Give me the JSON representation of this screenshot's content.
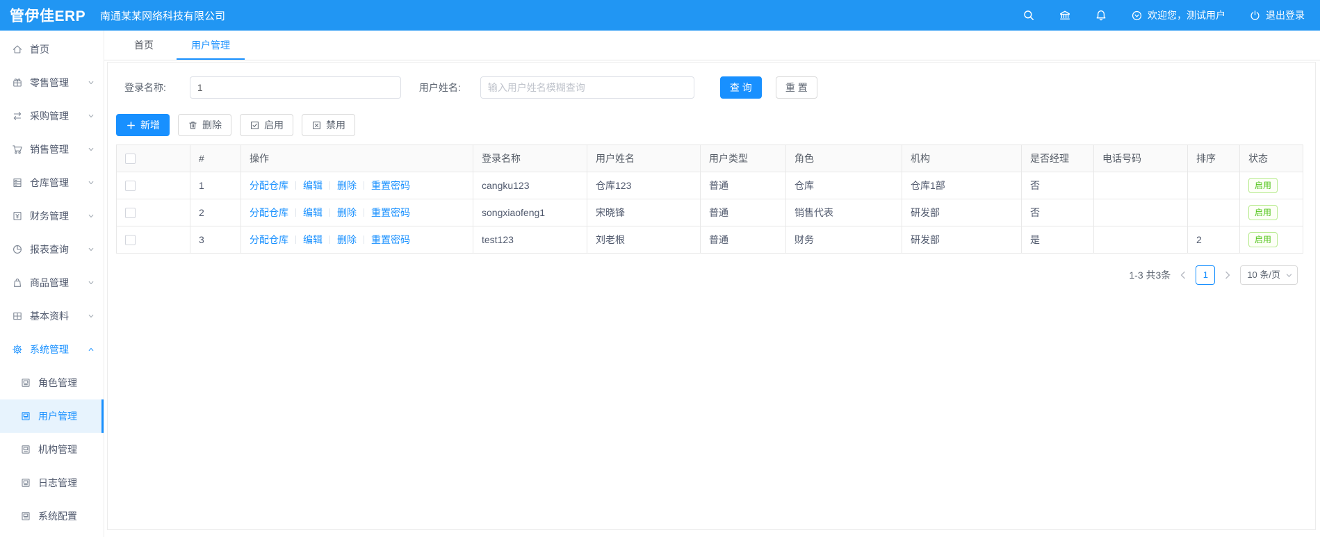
{
  "colors": {
    "topbar": "#2196f3",
    "primary": "#1890ff",
    "link": "#1890ff",
    "status_green": "#52c41a",
    "active_menu_bg": "#e7f3fd"
  },
  "header": {
    "logo": "管伊佳ERP",
    "company": "南通某某网络科技有限公司",
    "welcome": "欢迎您，测试用户",
    "logout": "退出登录"
  },
  "sidebar": {
    "items": [
      {
        "label": "首页",
        "icon": "home-icon"
      },
      {
        "label": "零售管理",
        "icon": "retail-icon"
      },
      {
        "label": "采购管理",
        "icon": "purchase-icon"
      },
      {
        "label": "销售管理",
        "icon": "sales-cart-icon"
      },
      {
        "label": "仓库管理",
        "icon": "warehouse-icon"
      },
      {
        "label": "财务管理",
        "icon": "finance-icon"
      },
      {
        "label": "报表查询",
        "icon": "report-pie-icon"
      },
      {
        "label": "商品管理",
        "icon": "goods-bag-icon"
      },
      {
        "label": "基本资料",
        "icon": "basic-data-icon"
      },
      {
        "label": "系统管理",
        "icon": "gear-icon",
        "active": true,
        "expanded": true
      }
    ],
    "subitems": [
      {
        "label": "角色管理"
      },
      {
        "label": "用户管理",
        "active": true
      },
      {
        "label": "机构管理"
      },
      {
        "label": "日志管理"
      },
      {
        "label": "系统配置"
      }
    ]
  },
  "tabs": [
    {
      "label": "首页"
    },
    {
      "label": "用户管理",
      "active": true
    }
  ],
  "filters": {
    "login_name_label": "登录名称:",
    "login_name_value": "1",
    "user_name_label": "用户姓名:",
    "user_name_placeholder": "输入用户姓名模糊查询",
    "search_label": "查 询",
    "reset_label": "重 置"
  },
  "toolbar": {
    "add_label": "新增",
    "delete_label": "删除",
    "enable_label": "启用",
    "disable_label": "禁用"
  },
  "table": {
    "columns": [
      "#",
      "操作",
      "登录名称",
      "用户姓名",
      "用户类型",
      "角色",
      "机构",
      "是否经理",
      "电话号码",
      "排序",
      "状态"
    ],
    "action_links": [
      "分配仓库",
      "编辑",
      "删除",
      "重置密码"
    ],
    "rows": [
      {
        "index": "1",
        "login_name": "cangku123",
        "user_name": "仓库123",
        "user_type": "普通",
        "role": "仓库",
        "org": "仓库1部",
        "is_manager": "否",
        "phone": "",
        "sort": "",
        "status": "启用"
      },
      {
        "index": "2",
        "login_name": "songxiaofeng1",
        "user_name": "宋晓锋",
        "user_type": "普通",
        "role": "销售代表",
        "org": "研发部",
        "is_manager": "否",
        "phone": "",
        "sort": "",
        "status": "启用"
      },
      {
        "index": "3",
        "login_name": "test123",
        "user_name": "刘老根",
        "user_type": "普通",
        "role": "财务",
        "org": "研发部",
        "is_manager": "是",
        "phone": "",
        "sort": "2",
        "status": "启用"
      }
    ]
  },
  "pagination": {
    "total_text": "1-3 共3条",
    "current_page": "1",
    "page_size": "10 条/页"
  }
}
